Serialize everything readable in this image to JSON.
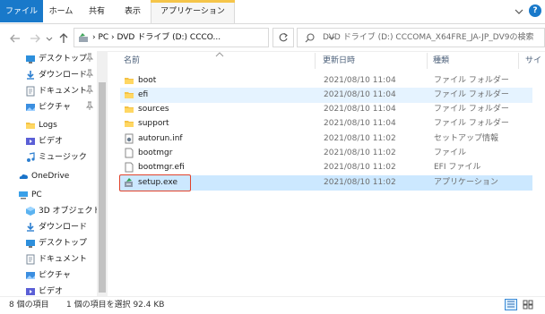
{
  "ribbon": {
    "tabs": [
      "ファイル",
      "ホーム",
      "共有",
      "表示",
      "アプリケーション ツール"
    ],
    "help": "?"
  },
  "address": {
    "path": "› PC › DVD ドライブ (D:) CCCO...",
    "search_placeholder": "DVD ドライブ (D:) CCCOMA_X64FRE_JA-JP_DV9の検索"
  },
  "sidebar": {
    "items": [
      {
        "label": "デスクトップ",
        "icon": "desktop-icon",
        "pinned": true
      },
      {
        "label": "ダウンロード",
        "icon": "download-icon",
        "pinned": true
      },
      {
        "label": "ドキュメント",
        "icon": "documents-icon",
        "pinned": true
      },
      {
        "label": "ピクチャ",
        "icon": "pictures-icon",
        "pinned": true
      },
      {
        "label": "Logs",
        "icon": "folder-icon",
        "pinned": false
      },
      {
        "label": "ビデオ",
        "icon": "videos-icon",
        "pinned": false
      },
      {
        "label": "ミュージック",
        "icon": "music-icon",
        "pinned": false
      },
      {
        "label": "OneDrive",
        "icon": "onedrive-icon",
        "pinned": false
      },
      {
        "label": "PC",
        "icon": "pc-icon",
        "pinned": false
      },
      {
        "label": "3D オブジェクト",
        "icon": "3d-objects-icon",
        "pinned": false
      },
      {
        "label": "ダウンロード",
        "icon": "download-icon",
        "pinned": false
      },
      {
        "label": "デスクトップ",
        "icon": "desktop-icon",
        "pinned": false
      },
      {
        "label": "ドキュメント",
        "icon": "documents-icon",
        "pinned": false
      },
      {
        "label": "ピクチャ",
        "icon": "pictures-icon",
        "pinned": false
      },
      {
        "label": "ビデオ",
        "icon": "videos-icon",
        "pinned": false
      }
    ]
  },
  "columns": {
    "name": "名前",
    "modified": "更新日時",
    "type": "種類",
    "size": "サイ"
  },
  "files": [
    {
      "name": "boot",
      "modified": "2021/08/10 11:04",
      "type": "ファイル フォルダー",
      "icon": "folder-icon"
    },
    {
      "name": "efi",
      "modified": "2021/08/10 11:04",
      "type": "ファイル フォルダー",
      "icon": "folder-icon"
    },
    {
      "name": "sources",
      "modified": "2021/08/10 11:04",
      "type": "ファイル フォルダー",
      "icon": "folder-icon"
    },
    {
      "name": "support",
      "modified": "2021/08/10 11:04",
      "type": "ファイル フォルダー",
      "icon": "folder-icon"
    },
    {
      "name": "autorun.inf",
      "modified": "2021/08/10 11:02",
      "type": "セットアップ情報",
      "icon": "setup-info-icon"
    },
    {
      "name": "bootmgr",
      "modified": "2021/08/10 11:02",
      "type": "ファイル",
      "icon": "file-icon"
    },
    {
      "name": "bootmgr.efi",
      "modified": "2021/08/10 11:02",
      "type": "EFI ファイル",
      "icon": "file-icon"
    },
    {
      "name": "setup.exe",
      "modified": "2021/08/10 11:02",
      "type": "アプリケーション",
      "icon": "setup-exe-icon"
    }
  ],
  "status": {
    "count": "8 個の項目",
    "selection": "1 個の項目を選択  92.4 KB"
  },
  "colors": {
    "accent": "#1979ca",
    "selected_row": "#cce8ff",
    "hover_row": "#e5f3ff",
    "folder": "#f4c244",
    "highlight_outline": "#e0422b"
  }
}
